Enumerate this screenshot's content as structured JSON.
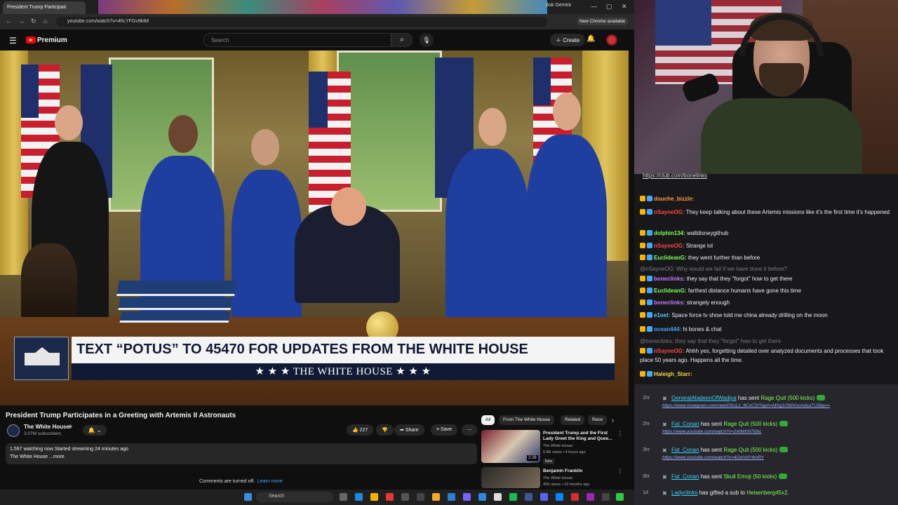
{
  "browser": {
    "tab_title": "President Trump Participati",
    "ask_gemini": "Ask Gemini",
    "url": "youtube.com/watch?v=4hLYFGv9ktM",
    "new_chrome": "New Chrome available"
  },
  "yt": {
    "brand": "Premium",
    "search_placeholder": "Search",
    "create_label": "Create"
  },
  "video": {
    "lower_third_main": "TEXT “POTUS” TO 45470 FOR UPDATES FROM THE WHITE HOUSE",
    "lower_third_sub": "★ ★ ★  THE WHITE HOUSE  ★ ★ ★",
    "title": "President Trump Participates in a Greeting with Artemis II Astronauts"
  },
  "channel": {
    "name": "The White House",
    "subscribers": "3.07M subscribers"
  },
  "actions": {
    "likes": "227",
    "share": "Share",
    "save": "Save"
  },
  "description": {
    "line1": "1,597 watching now  Started streaming 24 minutes ago",
    "line2": "The White House ...more"
  },
  "comments": {
    "off_text": "Comments are turned off.",
    "learn_more": "Learn more"
  },
  "chips": [
    "All",
    "From The White House",
    "Related",
    "Rece"
  ],
  "related": [
    {
      "title": "President Trump and the First Lady Greet the King and Quee...",
      "channel": "The White House",
      "meta": "6.8K views • 4 hours ago",
      "badge": "New",
      "duration": "2:28"
    },
    {
      "title": "Benjamin Franklin",
      "channel": "The White House",
      "meta": "45K views • 10 months ago"
    }
  ],
  "taskbar": {
    "search": "Search"
  },
  "chat": {
    "link": "https://club.com/bonelinks",
    "messages": [
      {
        "user": "douche_bizzle:",
        "text": "",
        "color": "u-orange"
      },
      {
        "user": "nSayneOG:",
        "text": "They keep talking about these Artemis missions like it's the first time it's happened",
        "color": "u-red"
      },
      {
        "user": "dolphin134:",
        "text": "waltdisneygithub",
        "color": "u-green"
      },
      {
        "user": "nSayneOG:",
        "text": "Strange lol",
        "color": "u-red"
      },
      {
        "user": "EuclideanG:",
        "text": "they went further than before",
        "color": "u-green"
      },
      {
        "user": "",
        "text": "@nSayneOG: Why would we fail if we have done it before?",
        "color": "dim"
      },
      {
        "user": "boneclinks:",
        "text": "they say that they \"forgot\" how to get there",
        "color": "u-purple"
      },
      {
        "user": "EuclideanG:",
        "text": "farthest distance humans have gone this time",
        "color": "u-green"
      },
      {
        "user": "boneclinks:",
        "text": "strangely enough",
        "color": "u-purple"
      },
      {
        "user": "e1oel:",
        "text": "Space force tv show told me china already drilling on the moon",
        "color": "u-cyan"
      },
      {
        "user": "ocean444:",
        "text": "hi bones & chat",
        "color": "u-blue"
      },
      {
        "user": "",
        "text": "@boneclinks: they say that they \"forgot\" how to get there",
        "color": "dim"
      },
      {
        "user": "nSayneOG:",
        "text": "Ahhh yes, forgetting detailed over analyzed documents and processes that took place 50 years ago. Happens all the time.",
        "color": "u-red"
      },
      {
        "user": "Haleigh_Starr:",
        "text": "",
        "color": "u-yellow"
      }
    ]
  },
  "events": [
    {
      "time": "1hr",
      "name": "GeneralAladeenOfWadiya",
      "action": "has sent",
      "gift": "Rage Quit (500 kicks)",
      "link": "https://www.instagram.com/reel/DXuLz_8CvCS/?igsh=MXg1OWVocmdsaTU3bg=="
    },
    {
      "time": "2hr",
      "name": "Fat_Conan",
      "action": "has sent",
      "gift": "Rage Quit (500 kicks)",
      "link": "https://www.youtube.com/watch?v=2AIMXNTkfxc"
    },
    {
      "time": "3hr",
      "name": "Fat_Conan",
      "action": "has sent",
      "gift": "Rage Quit (500 kicks)",
      "link": "https://www.youtube.com/watch?v=4CwVdY4mRY"
    },
    {
      "time": "3hr",
      "name": "Fat_Conan",
      "action": "has sent",
      "gift": "Skull Emoji (50 kicks)",
      "link": ""
    },
    {
      "time": "1d",
      "name": "Ladyclinks",
      "action": "has gifted a sub to",
      "gift": "Heisenberg45x2.",
      "link": ""
    }
  ]
}
